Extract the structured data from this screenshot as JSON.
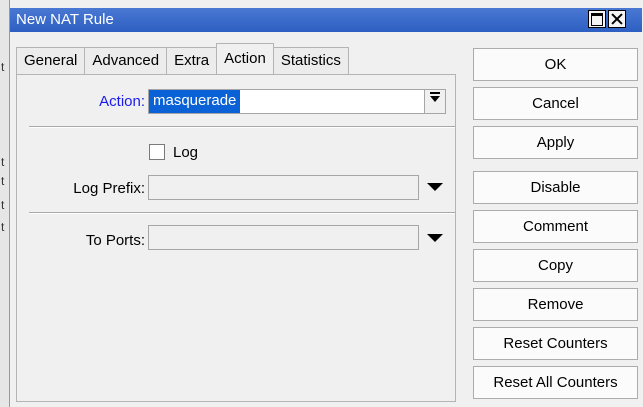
{
  "window": {
    "title": "New NAT Rule"
  },
  "tabs": [
    {
      "label": "General",
      "active": false
    },
    {
      "label": "Advanced",
      "active": false
    },
    {
      "label": "Extra",
      "active": false
    },
    {
      "label": "Action",
      "active": true
    },
    {
      "label": "Statistics",
      "active": false
    }
  ],
  "form": {
    "action": {
      "label": "Action:",
      "value": "masquerade"
    },
    "log": {
      "label": "Log",
      "checked": false
    },
    "log_prefix": {
      "label": "Log Prefix:",
      "value": ""
    },
    "to_ports": {
      "label": "To Ports:",
      "value": ""
    }
  },
  "buttons": {
    "ok": "OK",
    "cancel": "Cancel",
    "apply": "Apply",
    "disable": "Disable",
    "comment": "Comment",
    "copy": "Copy",
    "remove": "Remove",
    "reset_counters": "Reset Counters",
    "reset_all_counters": "Reset All Counters"
  },
  "background": {
    "row_marks": [
      "t",
      "t",
      "t",
      "t",
      "t"
    ]
  },
  "colors": {
    "titlebar": "#3c6ccb",
    "selection": "#0a62d6",
    "action_label": "#1a1aee"
  }
}
